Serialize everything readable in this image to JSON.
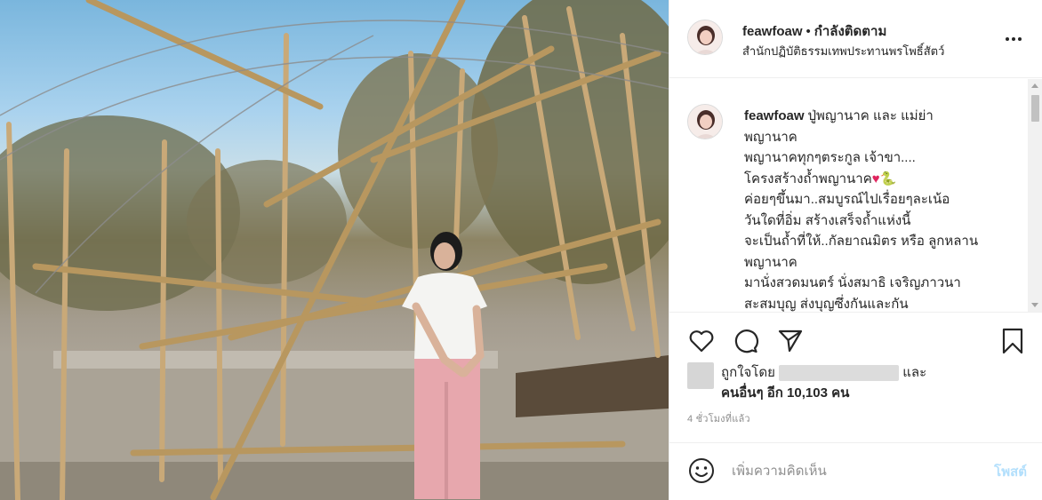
{
  "post": {
    "username": "feawfoaw",
    "follow_dot": "•",
    "follow_status": "กำลังติดตาม",
    "location": "สำนักปฏิบัติธรรมเทพประทานพรโพธิ์สัตว์",
    "more_icon": "more-horizontal-icon"
  },
  "caption": {
    "username": "feawfoaw",
    "lines": [
      "ปู่พญานาค และ แม่ย่า",
      "พญานาค",
      "พญานาคทุกๆตระกูล เจ้าขา....",
      "โครงสร้างถ้ำพญานาค",
      "ค่อยๆขึ้นมา..สมบูรณ์ไปเรื่อยๆละเน้อ",
      "วันใดที่อิ่ม สร้างเสร็จถ้ำแห่งนี้",
      "จะเป็นถ้ำที่ให้..กัลยาณมิตร หรือ ลูกหลาน",
      "พญานาค",
      "มานั่งสวดมนตร์ นั่งสมาธิ เจริญภาวนา",
      "สะสมบุญ ส่งบุญซึ่งกันและกัน"
    ],
    "emoji_heart": "♥",
    "emoji_snake": "🐍"
  },
  "actions": {
    "like_icon": "heart-icon",
    "comment_icon": "comment-bubble-icon",
    "share_icon": "paper-plane-icon",
    "save_icon": "bookmark-icon"
  },
  "likes": {
    "liked_by_prefix": "ถูกใจโดย",
    "and": "และ",
    "others_text": "คนอื่นๆ อีก 10,103 คน"
  },
  "timestamp": "4 ชั่วโมงที่แล้ว",
  "comment": {
    "placeholder": "เพิ่มความคิดเห็น",
    "post_label": "โพสต์",
    "post_color": "#b2dffc"
  }
}
